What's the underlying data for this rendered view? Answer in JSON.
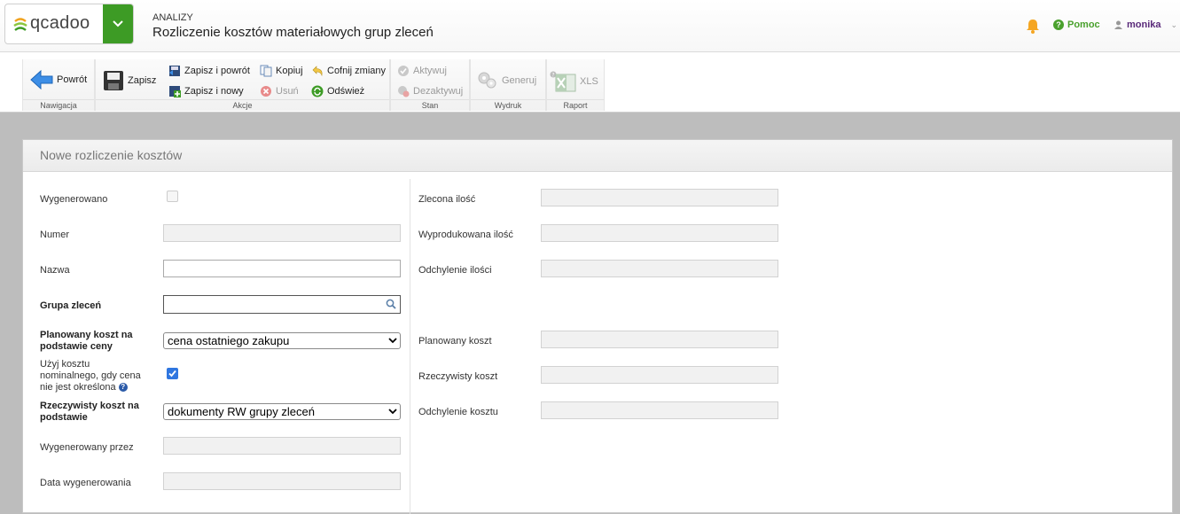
{
  "header": {
    "logo_text": "qcadoo",
    "section": "ANALIZY",
    "title": "Rozliczenie kosztów materiałowych grup zleceń",
    "help_label": "Pomoc",
    "user_name": "monika"
  },
  "ribbon": {
    "nav": {
      "label": "Nawigacja",
      "back": "Powrót"
    },
    "actions": {
      "label": "Akcje",
      "save": "Zapisz",
      "save_back": "Zapisz i powrót",
      "save_new": "Zapisz i nowy",
      "copy": "Kopiuj",
      "delete": "Usuń",
      "undo": "Cofnij zmiany",
      "refresh": "Odśwież"
    },
    "state": {
      "label": "Stan",
      "activate": "Aktywuj",
      "deactivate": "Dezaktywuj"
    },
    "print": {
      "label": "Wydruk",
      "generate": "Generuj"
    },
    "report": {
      "label": "Raport",
      "xls": "XLS"
    }
  },
  "panel": {
    "title": "Nowe rozliczenie kosztów",
    "left": {
      "generated": "Wygenerowano",
      "number": "Numer",
      "name": "Nazwa",
      "order_group": "Grupa zleceń",
      "planned_cost_l1": "Planowany koszt na",
      "planned_cost_l2": "podstawie ceny",
      "planned_cost_value": "cena ostatniego zakupu",
      "nominal_l1": "Użyj kosztu",
      "nominal_l2": "nominalnego, gdy cena",
      "nominal_l3": "nie jest określona",
      "real_cost_l1": "Rzeczywisty koszt na",
      "real_cost_l2": "podstawie",
      "real_cost_value": "dokumenty RW grupy zleceń",
      "generated_by": "Wygenerowany przez",
      "generated_date": "Data wygenerowania"
    },
    "right": {
      "ordered_qty": "Zlecona ilość",
      "produced_qty": "Wyprodukowana ilość",
      "qty_deviation": "Odchylenie ilości",
      "planned_cost": "Planowany koszt",
      "real_cost": "Rzeczywisty koszt",
      "cost_deviation": "Odchylenie kosztu"
    }
  },
  "colors": {
    "brand_green": "#3d9b25",
    "help_green": "#4aa12d",
    "user_purple": "#5a2a7a",
    "checkbox_blue": "#2f76e0"
  }
}
